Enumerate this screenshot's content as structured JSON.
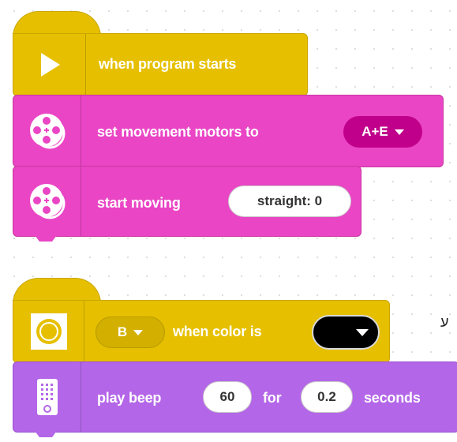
{
  "stack1": {
    "hat_label": "when program starts",
    "set_motors": {
      "label": "set movement motors to",
      "value": "A+E"
    },
    "start_moving": {
      "label": "start moving",
      "param": "straight: 0"
    }
  },
  "stack2": {
    "port": "B",
    "hat_label": "when color is",
    "color_value": "black",
    "play_beep": {
      "label": "play beep",
      "note": "60",
      "for_label": "for",
      "duration": "0.2",
      "unit_label": "seconds"
    }
  },
  "side_text": "ע",
  "colors": {
    "events_yellow": "#e6c000",
    "movement_magenta": "#ea45c5",
    "sound_purple": "#b466e8",
    "dropdown_magenta": "#c0008a"
  }
}
